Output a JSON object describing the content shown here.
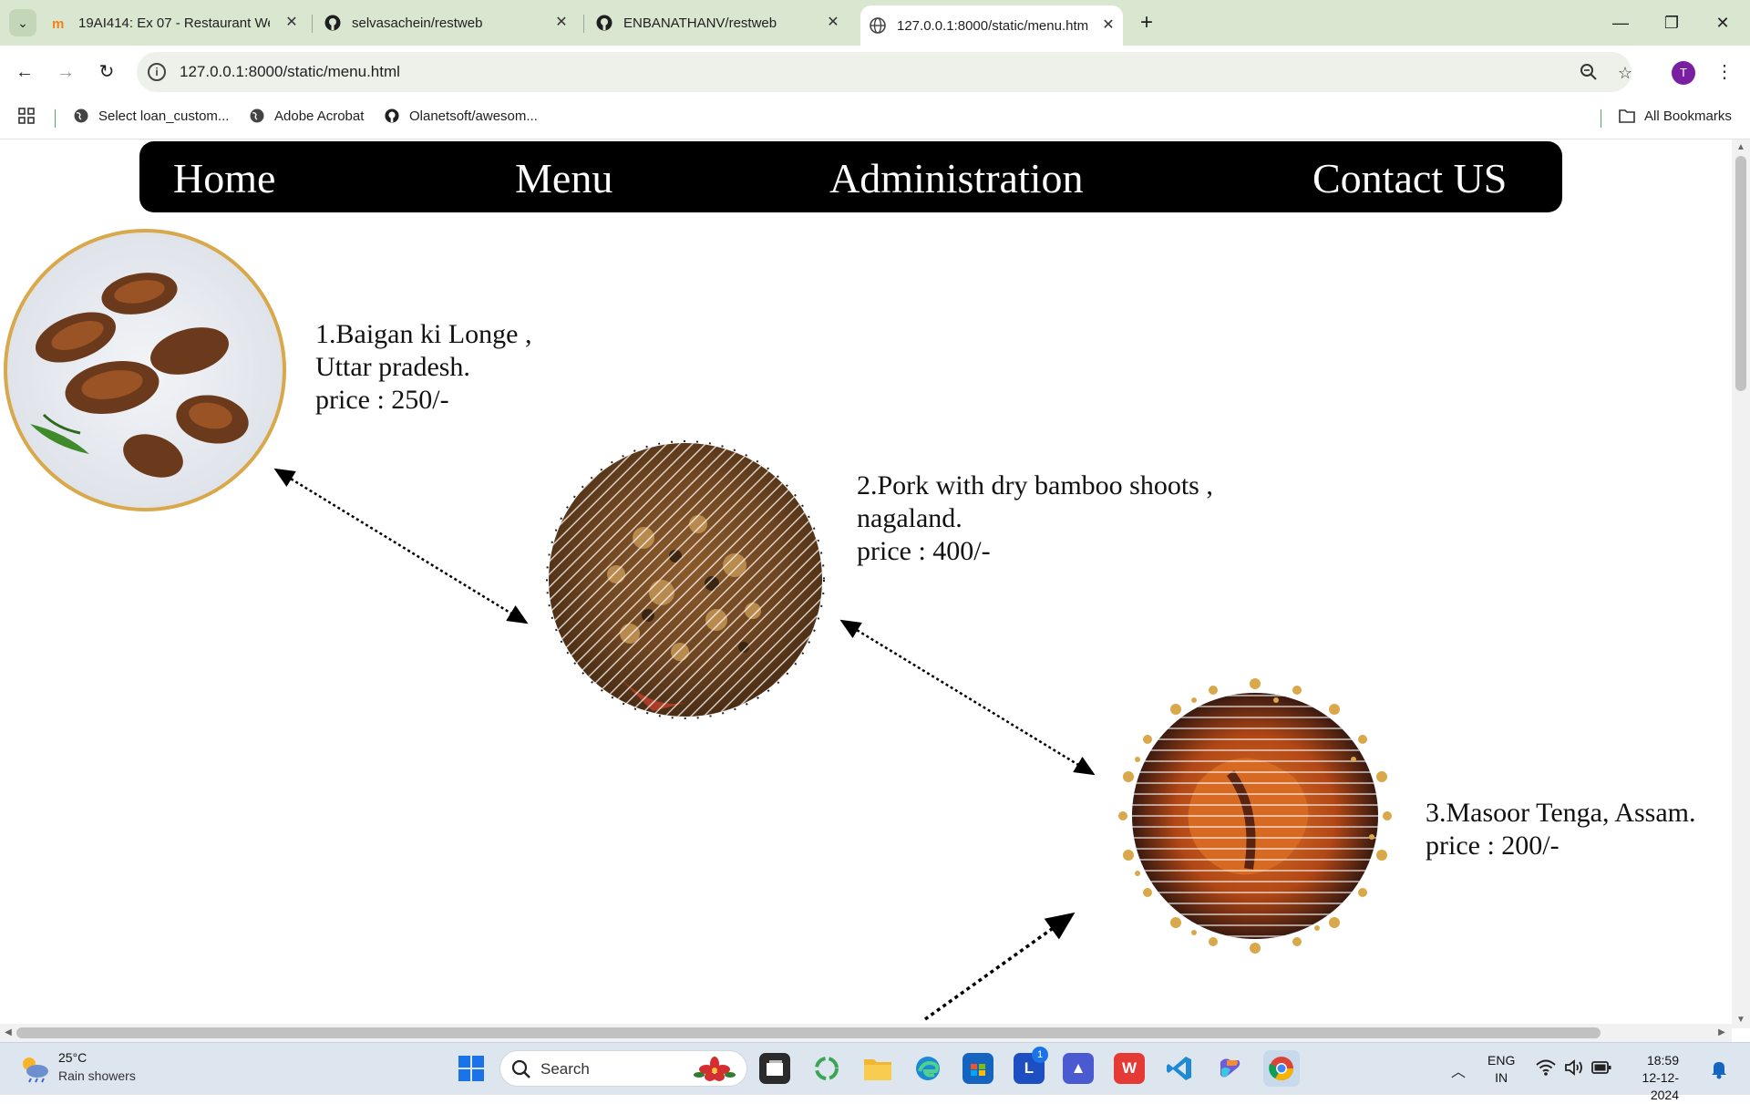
{
  "browser": {
    "tabs": [
      {
        "title": "19AI414: Ex 07 - Restaurant We",
        "icon": "moodle-icon"
      },
      {
        "title": "selvasachein/restweb",
        "icon": "github-icon"
      },
      {
        "title": "ENBANATHANV/restweb",
        "icon": "github-icon"
      },
      {
        "title": "127.0.0.1:8000/static/menu.htm",
        "icon": "globe-icon",
        "active": true
      }
    ],
    "url": "127.0.0.1:8000/static/menu.html",
    "profile_initial": "T",
    "bookmarks": [
      {
        "label": "Select loan_custom...",
        "icon": "globe-icon"
      },
      {
        "label": "Adobe Acrobat",
        "icon": "globe-icon"
      },
      {
        "label": "Olanetsoft/awesom...",
        "icon": "github-icon"
      }
    ],
    "all_bookmarks_label": "All Bookmarks"
  },
  "nav": {
    "home": "Home",
    "menu": "Menu",
    "administration": "Administration",
    "contact": "Contact US"
  },
  "dishes": [
    {
      "line1": "1.Baigan ki Longe ,",
      "line2": "Uttar pradesh.",
      "line3": "price : 250/-"
    },
    {
      "line1": "2.Pork with dry bamboo shoots ,",
      "line2": "nagaland.",
      "line3": "price : 400/-"
    },
    {
      "line1": "3.Masoor Tenga, Assam.",
      "line2": "price : 200/-"
    }
  ],
  "taskbar": {
    "weather_temp": "25°C",
    "weather_condition": "Rain showers",
    "search_label": "Search",
    "language": "ENG",
    "region": "IN",
    "time": "18:59",
    "date": "12-12-2024",
    "badge_count": "1"
  },
  "colors": {
    "nav_bg": "#000000",
    "tabbar_bg": "#d9e6d0",
    "taskbar_bg": "#dde6ef"
  }
}
